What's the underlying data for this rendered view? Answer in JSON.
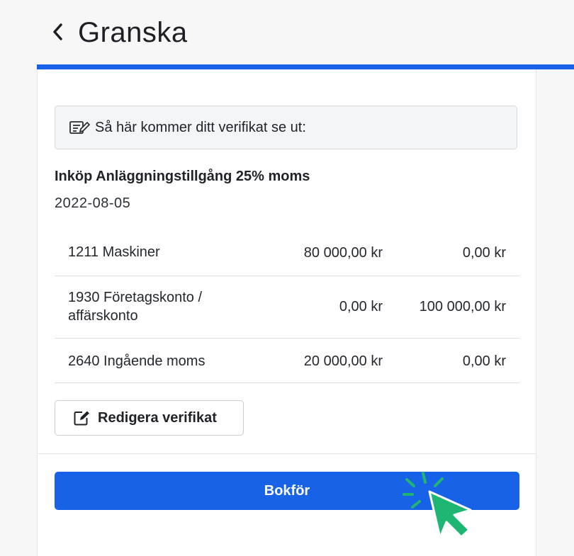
{
  "header": {
    "title": "Granska"
  },
  "notice": {
    "text": "Så här kommer ditt verifikat se ut:"
  },
  "voucher": {
    "title": "Inköp Anläggningstillgång 25% moms",
    "date": "2022-08-05",
    "rows": [
      {
        "account": "1211 Maskiner",
        "debit": "80 000,00 kr",
        "credit": "0,00 kr"
      },
      {
        "account": "1930 Företagskonto / affärskonto",
        "debit": "0,00 kr",
        "credit": "100 000,00 kr"
      },
      {
        "account": "2640 Ingående moms",
        "debit": "20 000,00 kr",
        "credit": "0,00 kr"
      }
    ]
  },
  "actions": {
    "edit_label": "Redigera verifikat",
    "book_label": "Bokför"
  },
  "colors": {
    "accent": "#1862e8",
    "cursor": "#1fb573"
  }
}
